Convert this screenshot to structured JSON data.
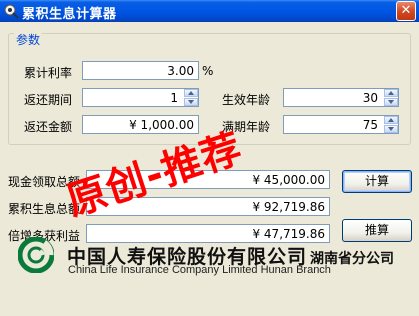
{
  "window": {
    "title": "累积生息计算器",
    "close_glyph": "✕"
  },
  "params": {
    "legend": "参数",
    "rate": {
      "label": "累计利率",
      "value": "3.00",
      "unit": "%"
    },
    "period": {
      "label": "返还期间",
      "value": "1"
    },
    "amount": {
      "label": "返还金额",
      "value": "¥ 1,000.00"
    },
    "start_age": {
      "label": "生效年龄",
      "value": "30"
    },
    "maturity_age": {
      "label": "满期年龄",
      "value": "75"
    }
  },
  "results": {
    "cash_total": {
      "label": "现金领取总额",
      "value": "¥ 45,000.00"
    },
    "accum_total": {
      "label": "累积生息总额",
      "value": "¥ 92,719.86"
    },
    "extra_gain": {
      "label": "倍增多获利益",
      "value": "¥ 47,719.86"
    }
  },
  "buttons": {
    "calculate": "计算",
    "reverse": "推算"
  },
  "watermark": "原创-推荐",
  "brand": {
    "cn": "中国人寿保险股份有限公司",
    "branch": "湖南省分公司",
    "en": "China Life Insurance Company Limited Hunan Branch",
    "green": "#0a7a3a"
  }
}
